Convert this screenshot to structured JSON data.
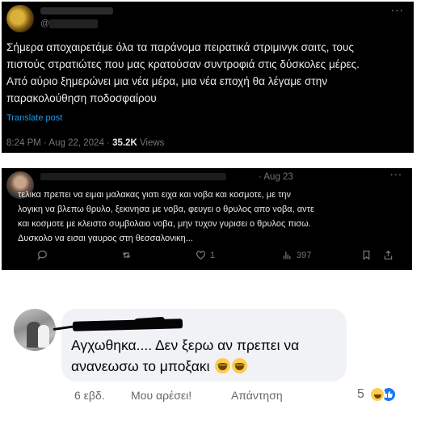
{
  "tweet1": {
    "handle": "@",
    "more_icon": "···",
    "lines": [
      "Σήμερα αποχαιρετάμε όλα τα παράνομα πειρατικά στριμινγκ σαιτς, τους",
      "πιστούς στρατιώτες που μας κρατούσαν συντροφιά στις δύσκολες μέρες.",
      "Από αύριο ξημερώνει μια νέα μέρα, μια νέα εποχή θα λέγαμε στην",
      "παρακολούθηση ποδοσφαίρου"
    ],
    "translate": "Translate post",
    "time_date": "8:24 PM · Aug 22, 2024 · ",
    "views_count": "35.2K",
    "views_label": " Views"
  },
  "tweet2": {
    "time": "· Aug 23",
    "more_icon": "···",
    "lines": [
      "τελικα πρεπει να ειμαι μαλακας γιατι ειχα και νοβα και κοσμοτε, με την",
      "λογικη να βλεπω θρυλο, ξεκινησα με νοβα, φευγει ο θρυλος απο νοβα, αντε",
      "και κοσμοτε με κλειστο συμβολαιο νοβα, μην τυχον γυρισει ο θρυλος πισω.",
      "Δυσκολο να εισαι γαυρος στη θεσσαλονικη..."
    ],
    "actions": {
      "reply_count": "",
      "retweet_count": "",
      "like_count": "1",
      "views_count": "397"
    }
  },
  "comment": {
    "text_line1": "Αγχωθηκα.... Δεν ξερω αν πρεπει να",
    "text_line2": "ανανεωσω το μποξακι",
    "emoji": [
      "grinning-squinting-face",
      "grinning-squinting-face"
    ],
    "time": "6 εβδ.",
    "like": "Μου αρέσει!",
    "reply": "Απάντηση",
    "reaction_count": "5",
    "reactions": [
      "haha",
      "like"
    ],
    "colors": {
      "like_blue": "#1877f2",
      "bubble": "#f0f2f5",
      "twitter_link": "#1d9bf0"
    }
  }
}
